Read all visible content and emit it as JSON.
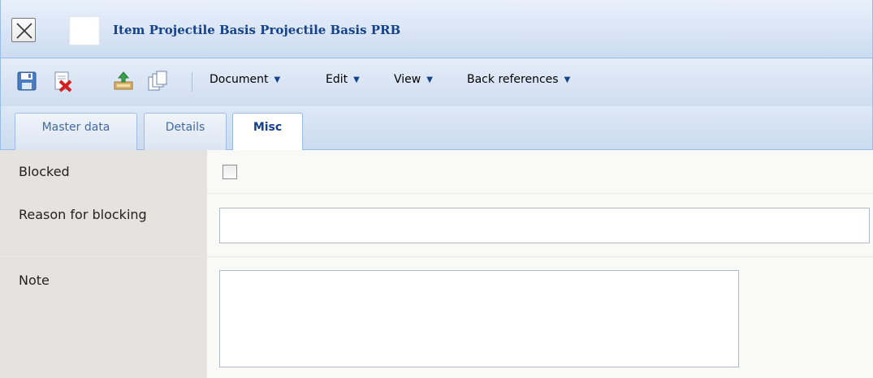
{
  "window": {
    "title": "Item Projectile Basis Projectile Basis PRB",
    "close_icon": "close-x-icon"
  },
  "toolbar": {
    "icons": [
      "save-icon",
      "delete-icon",
      "export-icon",
      "copy-icon"
    ],
    "menus": [
      {
        "label": "Document"
      },
      {
        "label": "Edit"
      },
      {
        "label": "View"
      },
      {
        "label": "Back references"
      }
    ],
    "dropdown_glyph": "▼"
  },
  "tabs": [
    {
      "label": "Master data",
      "active": false
    },
    {
      "label": "Details",
      "active": false
    },
    {
      "label": "Misc",
      "active": true
    }
  ],
  "form": {
    "blocked": {
      "label": "Blocked",
      "checked": false
    },
    "reason": {
      "label": "Reason for blocking",
      "value": ""
    },
    "note": {
      "label": "Note",
      "value": ""
    }
  },
  "colors": {
    "title_text": "#15428b",
    "panel_border": "#99bbe8",
    "label_column": "#e4e3df"
  }
}
